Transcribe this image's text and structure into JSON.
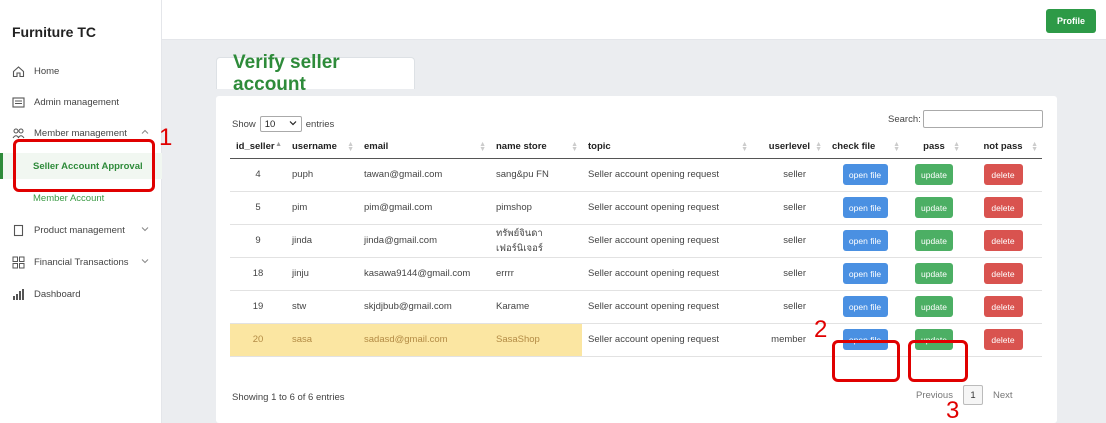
{
  "app": {
    "brand": "Furniture TC"
  },
  "topbar": {
    "profile_label": "Profile"
  },
  "sidebar": {
    "items": [
      {
        "label": "Home"
      },
      {
        "label": "Admin management"
      },
      {
        "label": "Member management"
      },
      {
        "label": "Seller Account Approval"
      },
      {
        "label": "Member Account"
      },
      {
        "label": "Product management"
      },
      {
        "label": "Financial Transactions"
      },
      {
        "label": "Dashboard"
      }
    ]
  },
  "page": {
    "title": "Verify seller account"
  },
  "table_controls": {
    "show_label": "Show",
    "entries_value": "10",
    "entries_label": "entries",
    "search_label": "Search:",
    "info": "Showing 1 to 6 of 6 entries",
    "previous": "Previous",
    "current_page": "1",
    "next": "Next"
  },
  "table": {
    "headers": [
      "id_seller",
      "username",
      "email",
      "name store",
      "topic",
      "userlevel",
      "check file",
      "pass",
      "not pass"
    ],
    "buttons": {
      "open": "open file",
      "update": "update",
      "delete": "delete"
    },
    "rows": [
      {
        "id": "4",
        "username": "puph",
        "email": "tawan@gmail.com",
        "store": "sang&pu FN",
        "topic": "Seller account opening request",
        "level": "seller"
      },
      {
        "id": "5",
        "username": "pim",
        "email": "pim@gmail.com",
        "store": "pimshop",
        "topic": "Seller account opening request",
        "level": "seller"
      },
      {
        "id": "9",
        "username": "jinda",
        "email": "jinda@gmail.com",
        "store": "ทรัพย์จินดา เฟอร์นิเจอร์",
        "topic": "Seller account opening request",
        "level": "seller"
      },
      {
        "id": "18",
        "username": "jinju",
        "email": "kasawa9144@gmail.com",
        "store": "errrr",
        "topic": "Seller account opening request",
        "level": "seller"
      },
      {
        "id": "19",
        "username": "stw",
        "email": "skjdjbub@gmail.com",
        "store": "Karame",
        "topic": "Seller account opening request",
        "level": "seller"
      },
      {
        "id": "20",
        "username": "sasa",
        "email": "sadasd@gmail.com",
        "store": "SasaShop",
        "topic": "Seller account opening request",
        "level": "member"
      }
    ]
  },
  "annotations": {
    "one": "1",
    "two": "2",
    "three": "3"
  },
  "colors": {
    "accent_green": "#2e8b3a",
    "open_blue": "#4a90e2",
    "update_green": "#4caf64",
    "delete_red": "#d9534f",
    "annotation_red": "#e00000",
    "highlight": "#fbe6a2"
  }
}
